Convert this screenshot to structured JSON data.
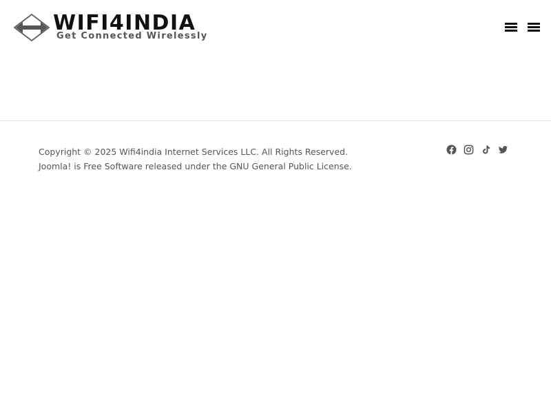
{
  "header": {
    "logo": {
      "title": "WIFI4INDIA",
      "tagline": "Get Connected Wirelessly",
      "mark_icon": "double-arrow-diamond-icon"
    },
    "menu_toggles": [
      {
        "icon": "menu-icon"
      },
      {
        "icon": "menu-icon"
      }
    ]
  },
  "footer": {
    "copyright_line": "Copyright © 2025 Wifi4india Internet Services LLC. All Rights Reserved.",
    "license_line": "Joomla! is Free Software released under the GNU General Public License.",
    "social_links": [
      {
        "icon": "facebook-icon"
      },
      {
        "icon": "instagram-icon"
      },
      {
        "icon": "tiktok-icon"
      },
      {
        "icon": "twitter-icon"
      }
    ]
  },
  "colors": {
    "text": "#555555",
    "heading": "#111111",
    "icon": "#555555",
    "divider": "#e5e5e5",
    "background": "#ffffff"
  }
}
